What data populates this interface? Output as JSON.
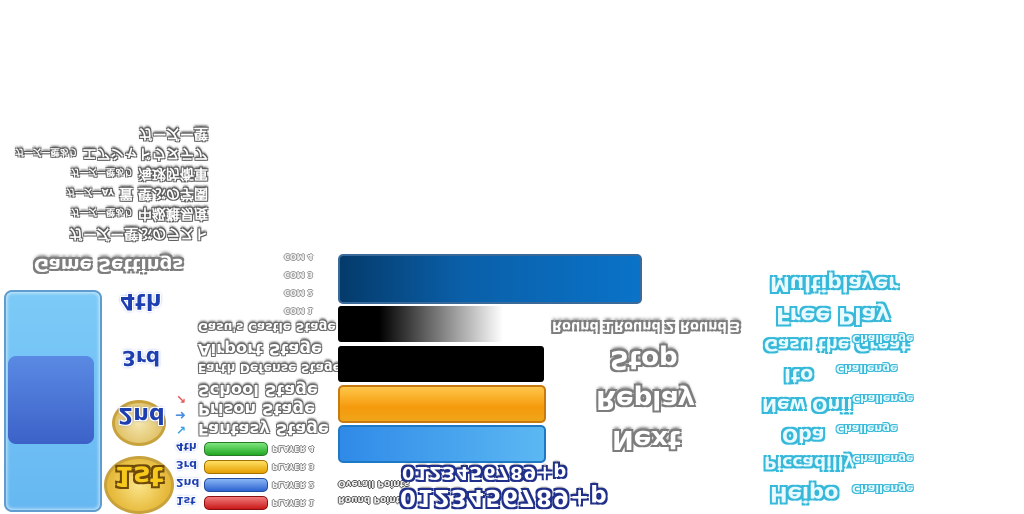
{
  "menu_jp": [
    {
      "label": "ガーズー壁",
      "tag": ""
    },
    {
      "label": "エアシャドウヌテア",
      "tag": "ガーズー壁あり"
    },
    {
      "label": "海球防衛軍",
      "tag": "ガーズー壁あり"
    },
    {
      "label": "置 壁ぶの学園",
      "tag": "ガーズーAY"
    },
    {
      "label": "中級難易度",
      "tag": "ガーズー壁あり"
    },
    {
      "label": "ガーズー壁ぶのラスト",
      "tag": ""
    }
  ],
  "game_settings": "Game Settings",
  "com_labels": [
    "COM 4",
    "COM 3",
    "COM 2",
    "COM 1"
  ],
  "stages": [
    "Gasu's Castle Stage",
    "Airport Stage",
    "Earth Defense Stage",
    "School Stage",
    "Prison Stage",
    "Fantasy Stage"
  ],
  "players": [
    {
      "rank": "4th",
      "label": "PLAYER 4",
      "color": "#3cc63c"
    },
    {
      "rank": "3rd",
      "label": "PLAYER 3",
      "color": "#f5b800"
    },
    {
      "rank": "2nd",
      "label": "PLAYER 2",
      "color": "#3f7fe0"
    },
    {
      "rank": "1st",
      "label": "PLAYER 1",
      "color": "#e02a2a"
    }
  ],
  "big_ranks": [
    "4th",
    "3rd",
    "2nd",
    "1st"
  ],
  "rounds": [
    "Round 1",
    "Round 2",
    "Round 3"
  ],
  "menu_buttons": [
    "Stop",
    "Replay",
    "Next"
  ],
  "points": {
    "overall_label": "Overall Points",
    "round_label": "Round Points",
    "digits": "0123456789+p"
  },
  "modes": [
    {
      "label": "Multiplayer",
      "tag": ""
    },
    {
      "label": "Free Play",
      "tag": ""
    },
    {
      "label": "Gasu the Great",
      "tag": "Challenge"
    },
    {
      "label": "Ito",
      "tag": "Challenge"
    },
    {
      "label": "New Onii",
      "tag": "Challenge"
    },
    {
      "label": "Oba",
      "tag": "Challenge"
    },
    {
      "label": "Piccadilly",
      "tag": "Challenge"
    },
    {
      "label": "Heipo",
      "tag": "Challenge"
    }
  ],
  "colors": {
    "bar_blue_dark": "#0a4f8e",
    "bar_orange": "#f59a0c",
    "bar_lightblue": "#3aa6ee",
    "panel_blue": "#4aa3ec",
    "cyan_outline": "#38b8d8",
    "digit_outline": "#1f2f8a"
  }
}
